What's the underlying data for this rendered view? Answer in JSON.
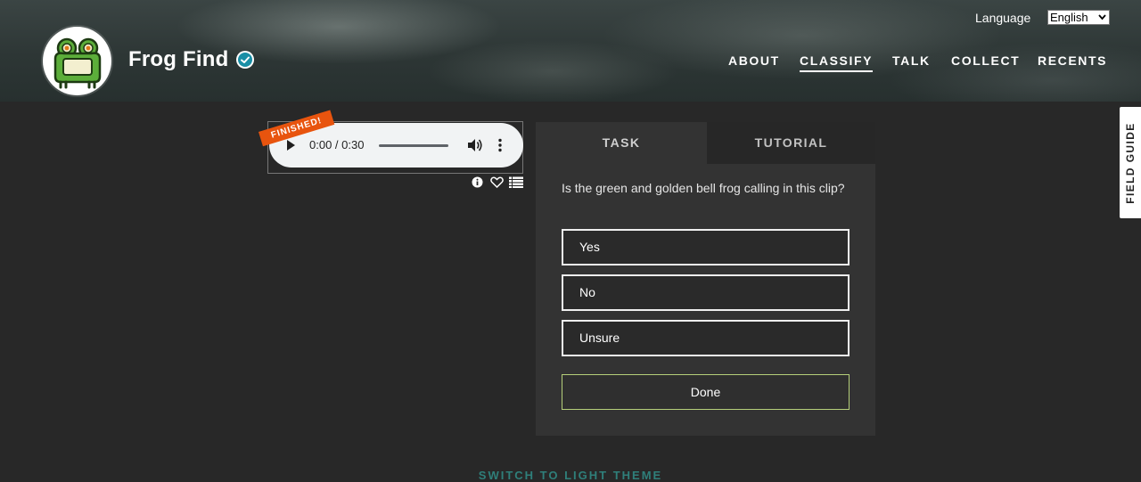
{
  "header": {
    "title": "Frog Find",
    "logo_icon": "frog-icon",
    "verified_icon": "check-badge-icon",
    "language_label": "Language",
    "language_selected": "English",
    "nav": [
      {
        "label": "ABOUT",
        "active": false
      },
      {
        "label": "CLASSIFY",
        "active": true
      },
      {
        "label": "TALK",
        "active": false
      },
      {
        "label": "COLLECT",
        "active": false
      },
      {
        "label": "RECENTS",
        "active": false
      }
    ]
  },
  "viewer": {
    "banner": "FINISHED!",
    "time": "0:00 / 0:30",
    "tools": [
      "info-icon",
      "heart-icon",
      "list-icon"
    ]
  },
  "task": {
    "tabs": [
      "TASK",
      "TUTORIAL"
    ],
    "question": "Is the green and golden bell frog calling in this clip?",
    "answers": [
      "Yes",
      "No",
      "Unsure"
    ],
    "done_label": "Done"
  },
  "field_guide_label": "FIELD GUIDE",
  "theme_switch_label": "SWITCH TO LIGHT THEME",
  "colors": {
    "background": "#282828",
    "panel": "#333333",
    "banner": "#e8540e",
    "done_border": "#b5cf7a"
  }
}
